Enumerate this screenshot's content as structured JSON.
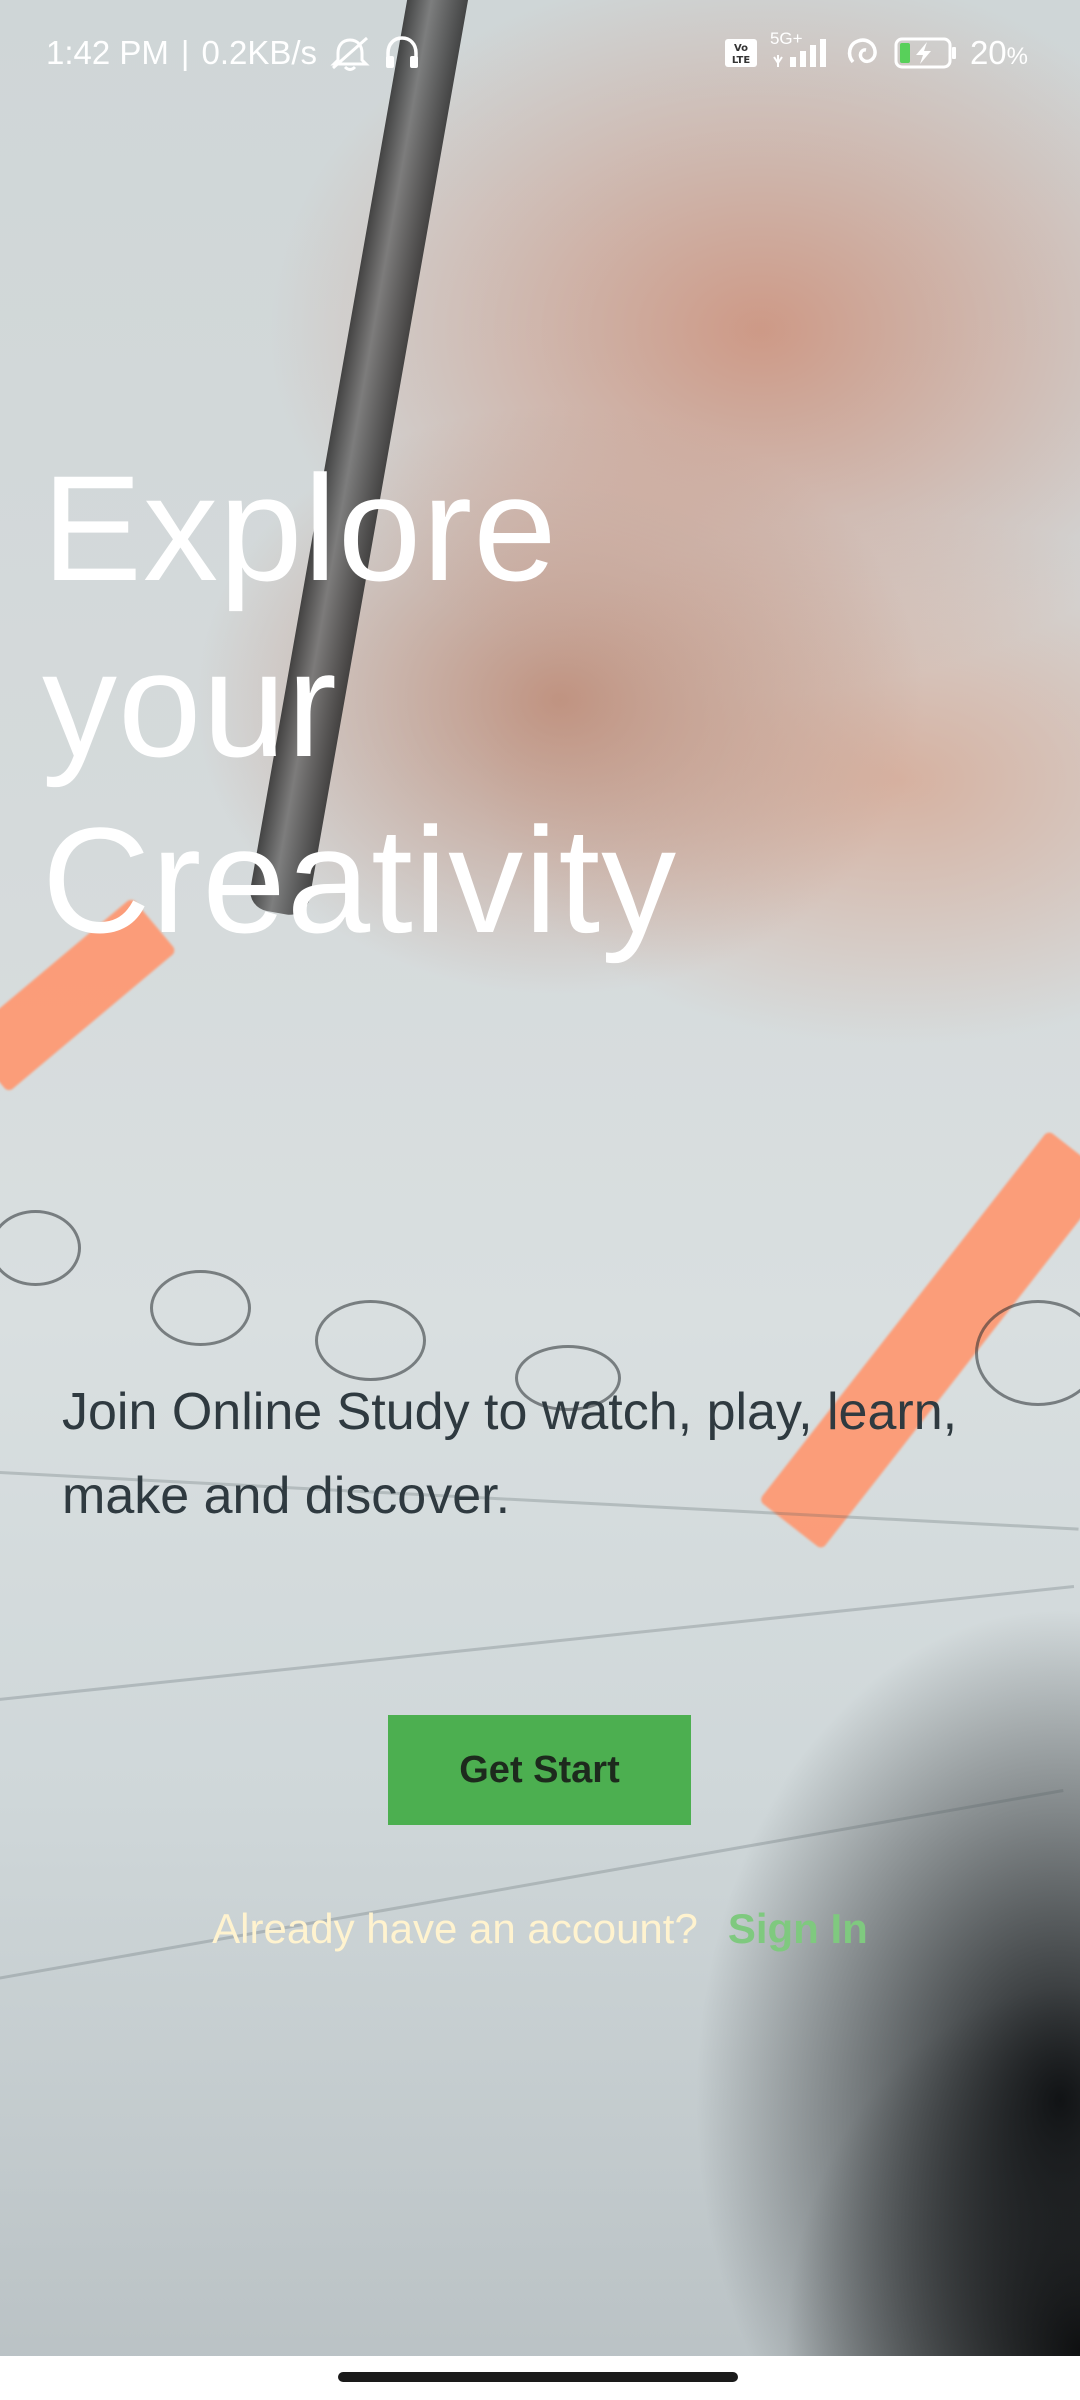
{
  "status_bar": {
    "time": "1:42 PM",
    "separator": "|",
    "network_speed": "0.2KB/s",
    "network_type": "5G+",
    "volte_badge": "Vo LTE",
    "battery_percent": "20",
    "battery_unit": "%",
    "battery_level": 0.2,
    "icons": [
      "alarm-off-icon",
      "headset-icon",
      "volte-icon",
      "signal-icon",
      "hotspot-icon",
      "battery-charging-icon"
    ]
  },
  "hero": {
    "headline_lines": [
      "Explore",
      "your",
      "Creativity"
    ],
    "subtext": "Join Online Study to watch, play, learn, make and discover."
  },
  "cta": {
    "label": "Get Start",
    "color": "#4caf50"
  },
  "signin": {
    "prompt": "Already have an account?",
    "link": "Sign In",
    "link_color": "#7fc97f"
  },
  "background": {
    "description_icon": "photo-background"
  }
}
